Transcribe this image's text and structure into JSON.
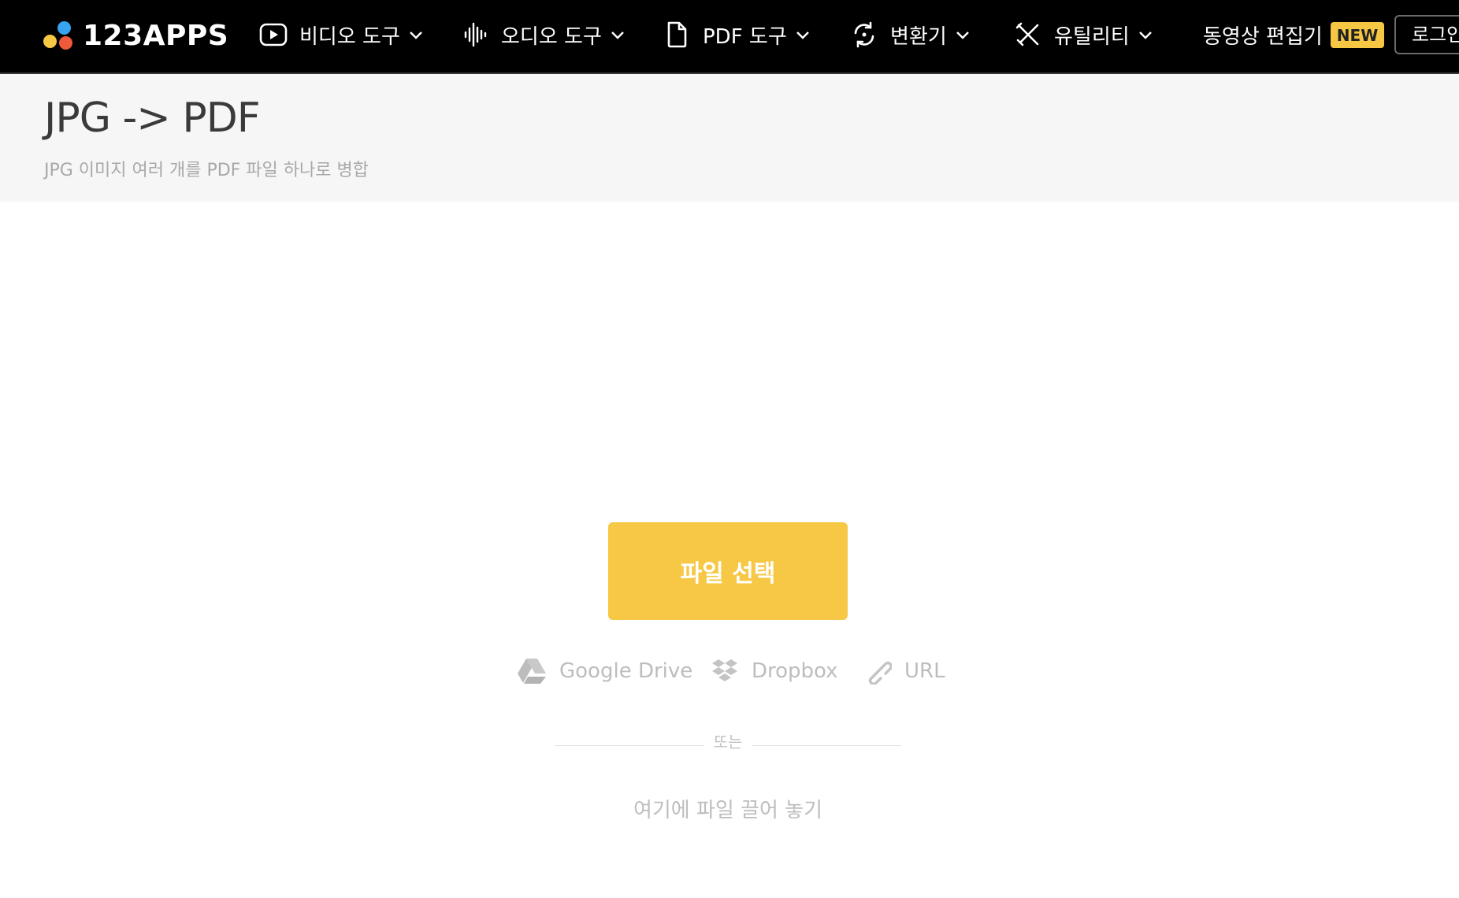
{
  "header": {
    "logo_text": "123APPS",
    "nav": [
      {
        "label": "비디오 도구",
        "icon": "video-play-icon"
      },
      {
        "label": "오디오 도구",
        "icon": "audio-wave-icon"
      },
      {
        "label": "PDF 도구",
        "icon": "document-icon"
      },
      {
        "label": "변환기",
        "icon": "convert-cycle-icon"
      },
      {
        "label": "유틸리티",
        "icon": "tools-icon"
      }
    ],
    "video_editor_label": "동영상 편집기",
    "new_badge": "NEW",
    "login_label": "로그인"
  },
  "page": {
    "title": "JPG -> PDF",
    "subtitle": "JPG 이미지 여러 개를 PDF 파일 하나로 병합"
  },
  "uploader": {
    "choose_file_label": "파일 선택",
    "sources": [
      {
        "label": "Google Drive",
        "icon": "google-drive-icon"
      },
      {
        "label": "Dropbox",
        "icon": "dropbox-icon"
      },
      {
        "label": "URL",
        "icon": "link-icon"
      }
    ],
    "or_label": "또는",
    "drop_label": "여기에 파일 끌어 놓기"
  },
  "colors": {
    "topbar_bg": "#000000",
    "accent": "#f6c846",
    "band_bg": "#f6f6f6"
  }
}
